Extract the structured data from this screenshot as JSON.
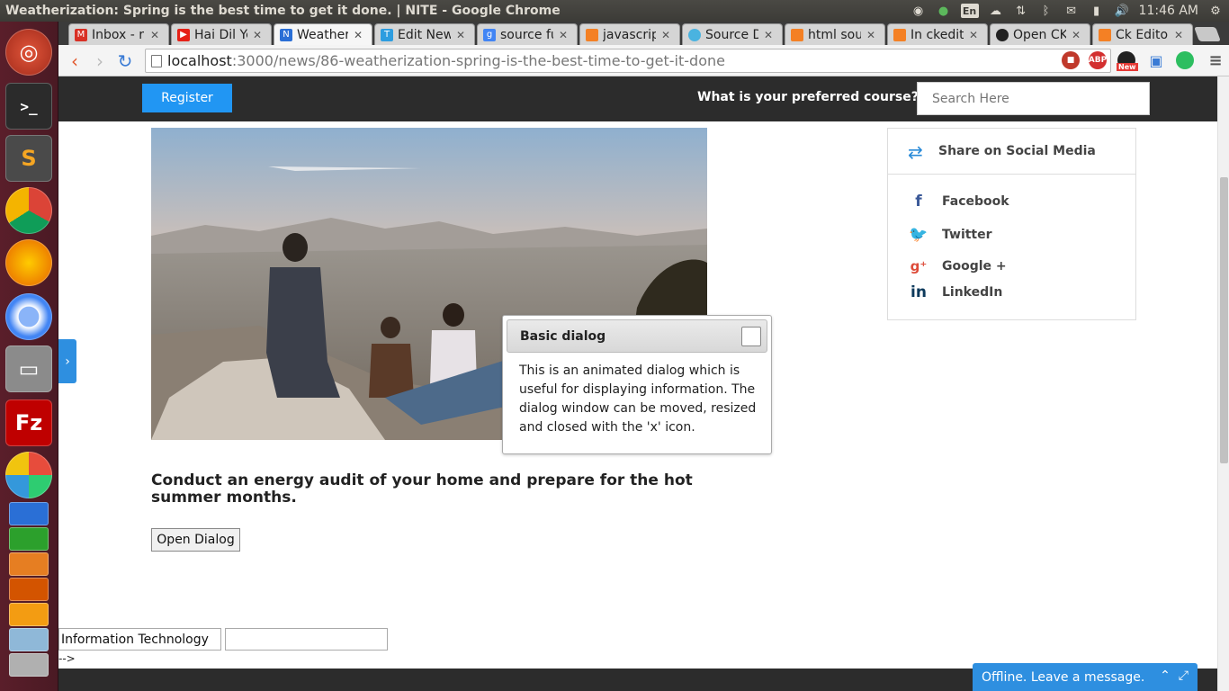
{
  "os": {
    "window_title": "Weatherization: Spring is the best time to get it done. | NITE - Google Chrome",
    "keyboard_layout": "En",
    "clock": "11:46 AM"
  },
  "browser": {
    "tabs": [
      {
        "label": "Inbox - rir",
        "icon": "gmail-icon"
      },
      {
        "label": "Hai Dil Ye",
        "icon": "youtube-icon"
      },
      {
        "label": "Weatheri",
        "icon": "nite-icon",
        "active": true
      },
      {
        "label": "Edit New",
        "icon": "t-icon"
      },
      {
        "label": "source fu",
        "icon": "google-icon"
      },
      {
        "label": "javascript",
        "icon": "stackoverflow-icon"
      },
      {
        "label": "Source Di",
        "icon": "ckeditor-icon"
      },
      {
        "label": "html sour",
        "icon": "stackoverflow-icon"
      },
      {
        "label": "In ckedito",
        "icon": "stackoverflow-icon"
      },
      {
        "label": "Open CKI",
        "icon": "github-icon"
      },
      {
        "label": "Ck Editor",
        "icon": "stackoverflow-icon"
      }
    ],
    "url_host": "localhost",
    "url_rest": ":3000/news/86-weatherization-spring-is-the-best-time-to-get-it-done",
    "ext_new_badge": "New",
    "ext_abp": "ABP"
  },
  "header": {
    "register_label": "Register",
    "question": "What is your preferred course?",
    "search_placeholder": "Search Here"
  },
  "article": {
    "headline": "Conduct an energy audit of your home and prepare for the hot summer months.",
    "open_dialog_label": "Open Dialog"
  },
  "dialog": {
    "title": "Basic dialog",
    "body": "This is an animated dialog which is useful for displaying information. The dialog window can be moved, resized and closed with the 'x' icon."
  },
  "share": {
    "title": "Share on Social Media",
    "items": [
      {
        "label": "Facebook",
        "icon": "facebook-icon",
        "color": "#3b5998"
      },
      {
        "label": "Twitter",
        "icon": "twitter-icon",
        "color": "#1da1f2"
      },
      {
        "label": "Google +",
        "icon": "google-plus-icon",
        "color": "#dd4b39"
      },
      {
        "label": "LinkedIn",
        "icon": "linkedin-icon",
        "color": "#0e3a5c"
      }
    ]
  },
  "form": {
    "course_value": "Information Technology",
    "stray_text": "-->"
  },
  "chat": {
    "label": "Offline. Leave a message."
  },
  "colors": {
    "accent": "#2196f3",
    "header_bg": "#2c2c2c"
  }
}
